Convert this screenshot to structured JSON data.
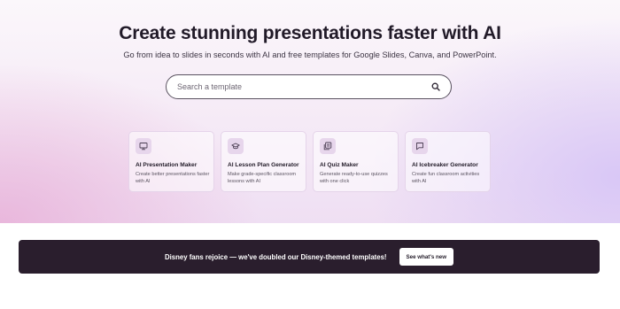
{
  "hero": {
    "title": "Create stunning presentations faster with AI",
    "subtitle": "Go from idea to slides in seconds with AI and free templates for Google Slides, Canva, and PowerPoint."
  },
  "search": {
    "placeholder": "Search a template",
    "icon": "search-icon"
  },
  "cards": [
    {
      "icon": "presentation-icon",
      "title": "AI Presentation Maker",
      "desc": "Create better presentations faster with AI"
    },
    {
      "icon": "graduation-cap-icon",
      "title": "AI Lesson Plan Generator",
      "desc": "Make grade-specific classroom lessons with AI"
    },
    {
      "icon": "quiz-icon",
      "title": "AI Quiz Maker",
      "desc": "Generate ready-to-use quizzes with one click"
    },
    {
      "icon": "chat-icon",
      "title": "AI Icebreaker Generator",
      "desc": "Create fun classroom activities with AI"
    }
  ],
  "banner": {
    "text": "Disney fans rejoice — we've doubled our Disney-themed templates!",
    "button_label": "See what's new"
  },
  "colors": {
    "accent_icon_bg": "#e7d6ec",
    "banner_bg": "#2a1e2d"
  }
}
